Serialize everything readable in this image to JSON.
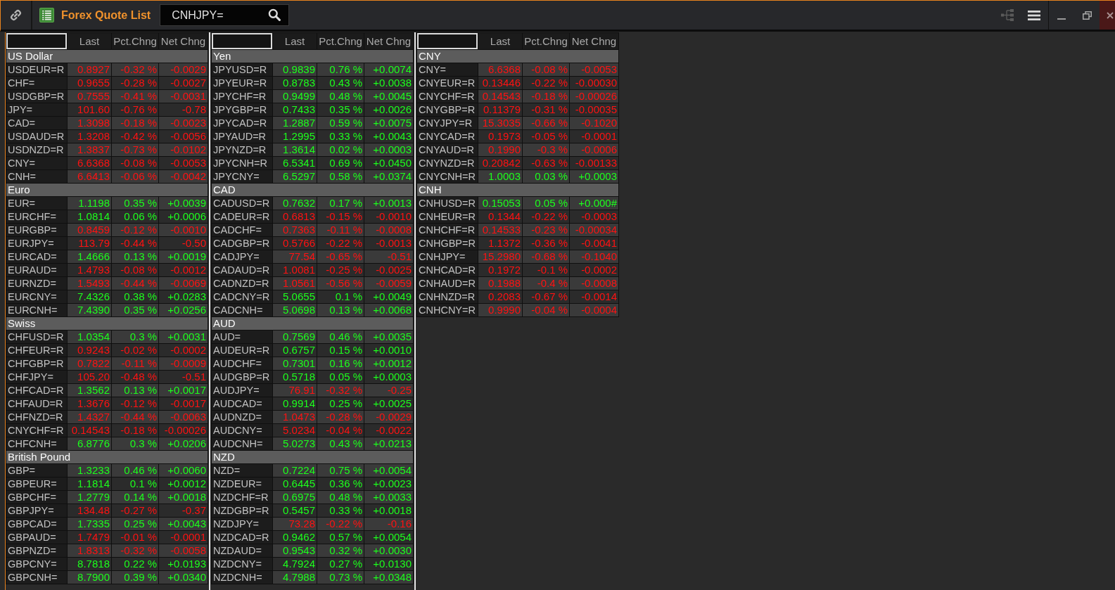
{
  "window": {
    "title": "Forex Quote List",
    "search": {
      "value": "CNHJPY="
    }
  },
  "quote_lists": [
    {
      "columns": [
        "Last",
        "Pct.Chng",
        "Net Chng"
      ],
      "groups": [
        {
          "heading": "US Dollar",
          "rows": [
            {
              "symbol": "USDEUR=R",
              "last": "0.8927",
              "pct_change": "-0.32 %",
              "net_change": "-0.0029",
              "rising": false
            },
            {
              "symbol": "CHF=",
              "last": "0.9655",
              "pct_change": "-0.28 %",
              "net_change": "-0.0027",
              "rising": false
            },
            {
              "symbol": "USDGBP=R",
              "last": "0.7555",
              "pct_change": "-0.41 %",
              "net_change": "-0.0031",
              "rising": false
            },
            {
              "symbol": "JPY=",
              "last": "101.60",
              "pct_change": "-0.76 %",
              "net_change": "-0.78",
              "rising": false
            },
            {
              "symbol": "CAD=",
              "last": "1.3098",
              "pct_change": "-0.18 %",
              "net_change": "-0.0023",
              "rising": false
            },
            {
              "symbol": "USDAUD=R",
              "last": "1.3208",
              "pct_change": "-0.42 %",
              "net_change": "-0.0056",
              "rising": false
            },
            {
              "symbol": "USDNZD=R",
              "last": "1.3837",
              "pct_change": "-0.73 %",
              "net_change": "-0.0102",
              "rising": false
            },
            {
              "symbol": "CNY=",
              "last": "6.6368",
              "pct_change": "-0.08 %",
              "net_change": "-0.0053",
              "rising": false
            },
            {
              "symbol": "CNH=",
              "last": "6.6413",
              "pct_change": "-0.06 %",
              "net_change": "-0.0042",
              "rising": false
            }
          ]
        },
        {
          "heading": "Euro",
          "rows": [
            {
              "symbol": "EUR=",
              "last": "1.1198",
              "pct_change": "0.35 %",
              "net_change": "+0.0039",
              "rising": true
            },
            {
              "symbol": "EURCHF=",
              "last": "1.0814",
              "pct_change": "0.06 %",
              "net_change": "+0.0006",
              "rising": true
            },
            {
              "symbol": "EURGBP=",
              "last": "0.8459",
              "pct_change": "-0.12 %",
              "net_change": "-0.0010",
              "rising": false
            },
            {
              "symbol": "EURJPY=",
              "last": "113.79",
              "pct_change": "-0.44 %",
              "net_change": "-0.50",
              "rising": false
            },
            {
              "symbol": "EURCAD=",
              "last": "1.4666",
              "pct_change": "0.13 %",
              "net_change": "+0.0019",
              "rising": true
            },
            {
              "symbol": "EURAUD=",
              "last": "1.4793",
              "pct_change": "-0.08 %",
              "net_change": "-0.0012",
              "rising": false
            },
            {
              "symbol": "EURNZD=",
              "last": "1.5493",
              "pct_change": "-0.44 %",
              "net_change": "-0.0069",
              "rising": false
            },
            {
              "symbol": "EURCNY=",
              "last": "7.4326",
              "pct_change": "0.38 %",
              "net_change": "+0.0283",
              "rising": true
            },
            {
              "symbol": "EURCNH=",
              "last": "7.4390",
              "pct_change": "0.35 %",
              "net_change": "+0.0256",
              "rising": true
            }
          ]
        },
        {
          "heading": "Swiss",
          "rows": [
            {
              "symbol": "CHFUSD=R",
              "last": "1.0354",
              "pct_change": "0.3 %",
              "net_change": "+0.0031",
              "rising": true
            },
            {
              "symbol": "CHFEUR=R",
              "last": "0.9243",
              "pct_change": "-0.02 %",
              "net_change": "-0.0002",
              "rising": false
            },
            {
              "symbol": "CHFGBP=R",
              "last": "0.7822",
              "pct_change": "-0.11 %",
              "net_change": "-0.0009",
              "rising": false
            },
            {
              "symbol": "CHFJPY=",
              "last": "105.20",
              "pct_change": "-0.48 %",
              "net_change": "-0.51",
              "rising": false
            },
            {
              "symbol": "CHFCAD=R",
              "last": "1.3562",
              "pct_change": "0.13 %",
              "net_change": "+0.0017",
              "rising": true
            },
            {
              "symbol": "CHFAUD=R",
              "last": "1.3676",
              "pct_change": "-0.12 %",
              "net_change": "-0.0017",
              "rising": false
            },
            {
              "symbol": "CHFNZD=R",
              "last": "1.4327",
              "pct_change": "-0.44 %",
              "net_change": "-0.0063",
              "rising": false
            },
            {
              "symbol": "CNYCHF=R",
              "last": "0.14543",
              "pct_change": "-0.18 %",
              "net_change": "-0.00026",
              "rising": false
            },
            {
              "symbol": "CHFCNH=",
              "last": "6.8776",
              "pct_change": "0.3 %",
              "net_change": "+0.0206",
              "rising": true
            }
          ]
        },
        {
          "heading": "British Pound",
          "rows": [
            {
              "symbol": "GBP=",
              "last": "1.3233",
              "pct_change": "0.46 %",
              "net_change": "+0.0060",
              "rising": true
            },
            {
              "symbol": "GBPEUR=",
              "last": "1.1814",
              "pct_change": "0.1 %",
              "net_change": "+0.0012",
              "rising": true
            },
            {
              "symbol": "GBPCHF=",
              "last": "1.2779",
              "pct_change": "0.14 %",
              "net_change": "+0.0018",
              "rising": true
            },
            {
              "symbol": "GBPJPY=",
              "last": "134.48",
              "pct_change": "-0.27 %",
              "net_change": "-0.37",
              "rising": false
            },
            {
              "symbol": "GBPCAD=",
              "last": "1.7335",
              "pct_change": "0.25 %",
              "net_change": "+0.0043",
              "rising": true
            },
            {
              "symbol": "GBPAUD=",
              "last": "1.7479",
              "pct_change": "-0.01 %",
              "net_change": "-0.0001",
              "rising": false
            },
            {
              "symbol": "GBPNZD=",
              "last": "1.8313",
              "pct_change": "-0.32 %",
              "net_change": "-0.0058",
              "rising": false
            },
            {
              "symbol": "GBPCNY=",
              "last": "8.7818",
              "pct_change": "0.22 %",
              "net_change": "+0.0193",
              "rising": true
            },
            {
              "symbol": "GBPCNH=",
              "last": "8.7900",
              "pct_change": "0.39 %",
              "net_change": "+0.0340",
              "rising": true
            }
          ]
        }
      ]
    },
    {
      "columns": [
        "Last",
        "Pct.Chng",
        "Net Chng"
      ],
      "groups": [
        {
          "heading": "Yen",
          "rows": [
            {
              "symbol": "JPYUSD=R",
              "last": "0.9839",
              "pct_change": "0.76 %",
              "net_change": "+0.0074",
              "rising": true
            },
            {
              "symbol": "JPYEUR=R",
              "last": "0.8783",
              "pct_change": "0.43 %",
              "net_change": "+0.0038",
              "rising": true
            },
            {
              "symbol": "JPYCHF=R",
              "last": "0.9499",
              "pct_change": "0.48 %",
              "net_change": "+0.0045",
              "rising": true
            },
            {
              "symbol": "JPYGBP=R",
              "last": "0.7433",
              "pct_change": "0.35 %",
              "net_change": "+0.0026",
              "rising": true
            },
            {
              "symbol": "JPYCAD=R",
              "last": "1.2887",
              "pct_change": "0.59 %",
              "net_change": "+0.0075",
              "rising": true
            },
            {
              "symbol": "JPYAUD=R",
              "last": "1.2995",
              "pct_change": "0.33 %",
              "net_change": "+0.0043",
              "rising": true
            },
            {
              "symbol": "JPYNZD=R",
              "last": "1.3614",
              "pct_change": "0.02 %",
              "net_change": "+0.0003",
              "rising": true
            },
            {
              "symbol": "JPYCNH=R",
              "last": "6.5341",
              "pct_change": "0.69 %",
              "net_change": "+0.0450",
              "rising": true
            },
            {
              "symbol": "JPYCNY=",
              "last": "6.5297",
              "pct_change": "0.58 %",
              "net_change": "+0.0374",
              "rising": true
            }
          ]
        },
        {
          "heading": "CAD",
          "rows": [
            {
              "symbol": "CADUSD=R",
              "last": "0.7632",
              "pct_change": "0.17 %",
              "net_change": "+0.0013",
              "rising": true
            },
            {
              "symbol": "CADEUR=R",
              "last": "0.6813",
              "pct_change": "-0.15 %",
              "net_change": "-0.0010",
              "rising": false
            },
            {
              "symbol": "CADCHF=",
              "last": "0.7363",
              "pct_change": "-0.11 %",
              "net_change": "-0.0008",
              "rising": false
            },
            {
              "symbol": "CADGBP=R",
              "last": "0.5766",
              "pct_change": "-0.22 %",
              "net_change": "-0.0013",
              "rising": false
            },
            {
              "symbol": "CADJPY=",
              "last": "77.54",
              "pct_change": "-0.65 %",
              "net_change": "-0.51",
              "rising": false
            },
            {
              "symbol": "CADAUD=R",
              "last": "1.0081",
              "pct_change": "-0.25 %",
              "net_change": "-0.0025",
              "rising": false
            },
            {
              "symbol": "CADNZD=R",
              "last": "1.0561",
              "pct_change": "-0.56 %",
              "net_change": "-0.0059",
              "rising": false
            },
            {
              "symbol": "CADCNY=R",
              "last": "5.0655",
              "pct_change": "0.1 %",
              "net_change": "+0.0049",
              "rising": true
            },
            {
              "symbol": "CADCNH=",
              "last": "5.0698",
              "pct_change": "0.13 %",
              "net_change": "+0.0068",
              "rising": true
            }
          ]
        },
        {
          "heading": "AUD",
          "rows": [
            {
              "symbol": "AUD=",
              "last": "0.7569",
              "pct_change": "0.46 %",
              "net_change": "+0.0035",
              "rising": true
            },
            {
              "symbol": "AUDEUR=R",
              "last": "0.6757",
              "pct_change": "0.15 %",
              "net_change": "+0.0010",
              "rising": true
            },
            {
              "symbol": "AUDCHF=",
              "last": "0.7301",
              "pct_change": "0.16 %",
              "net_change": "+0.0012",
              "rising": true
            },
            {
              "symbol": "AUDGBP=R",
              "last": "0.5718",
              "pct_change": "0.05 %",
              "net_change": "+0.0003",
              "rising": true
            },
            {
              "symbol": "AUDJPY=",
              "last": "76.91",
              "pct_change": "-0.32 %",
              "net_change": "-0.25",
              "rising": false
            },
            {
              "symbol": "AUDCAD=",
              "last": "0.9914",
              "pct_change": "0.25 %",
              "net_change": "+0.0025",
              "rising": true
            },
            {
              "symbol": "AUDNZD=",
              "last": "1.0473",
              "pct_change": "-0.28 %",
              "net_change": "-0.0029",
              "rising": false
            },
            {
              "symbol": "AUDCNY=",
              "last": "5.0234",
              "pct_change": "-0.04 %",
              "net_change": "-0.0022",
              "rising": false
            },
            {
              "symbol": "AUDCNH=",
              "last": "5.0273",
              "pct_change": "0.43 %",
              "net_change": "+0.0213",
              "rising": true
            }
          ]
        },
        {
          "heading": "NZD",
          "rows": [
            {
              "symbol": "NZD=",
              "last": "0.7224",
              "pct_change": "0.75 %",
              "net_change": "+0.0054",
              "rising": true
            },
            {
              "symbol": "NZDEUR=",
              "last": "0.6445",
              "pct_change": "0.36 %",
              "net_change": "+0.0023",
              "rising": true
            },
            {
              "symbol": "NZDCHF=R",
              "last": "0.6975",
              "pct_change": "0.48 %",
              "net_change": "+0.0033",
              "rising": true
            },
            {
              "symbol": "NZDGBP=R",
              "last": "0.5457",
              "pct_change": "0.33 %",
              "net_change": "+0.0018",
              "rising": true
            },
            {
              "symbol": "NZDJPY=",
              "last": "73.28",
              "pct_change": "-0.22 %",
              "net_change": "-0.16",
              "rising": false
            },
            {
              "symbol": "NZDCAD=R",
              "last": "0.9462",
              "pct_change": "0.57 %",
              "net_change": "+0.0054",
              "rising": true
            },
            {
              "symbol": "NZDAUD=",
              "last": "0.9543",
              "pct_change": "0.32 %",
              "net_change": "+0.0030",
              "rising": true
            },
            {
              "symbol": "NZDCNY=",
              "last": "4.7924",
              "pct_change": "0.27 %",
              "net_change": "+0.0130",
              "rising": true
            },
            {
              "symbol": "NZDCNH=",
              "last": "4.7988",
              "pct_change": "0.73 %",
              "net_change": "+0.0348",
              "rising": true
            }
          ]
        }
      ]
    },
    {
      "columns": [
        "Last",
        "Pct.Chng",
        "Net Chng"
      ],
      "groups": [
        {
          "heading": "CNY",
          "rows": [
            {
              "symbol": "CNY=",
              "last": "6.6368",
              "pct_change": "-0.08 %",
              "net_change": "-0.0053",
              "rising": false
            },
            {
              "symbol": "CNYEUR=R",
              "last": "0.13446",
              "pct_change": "-0.22 %",
              "net_change": "-0.00030",
              "rising": false
            },
            {
              "symbol": "CNYCHF=R",
              "last": "0.14543",
              "pct_change": "-0.18 %",
              "net_change": "-0.00026",
              "rising": false
            },
            {
              "symbol": "CNYGBP=R",
              "last": "0.11379",
              "pct_change": "-0.31 %",
              "net_change": "-0.00035",
              "rising": false
            },
            {
              "symbol": "CNYJPY=R",
              "last": "15.3035",
              "pct_change": "-0.66 %",
              "net_change": "-0.1020",
              "rising": false
            },
            {
              "symbol": "CNYCAD=R",
              "last": "0.1973",
              "pct_change": "-0.05 %",
              "net_change": "-0.0001",
              "rising": false
            },
            {
              "symbol": "CNYAUD=R",
              "last": "0.1990",
              "pct_change": "-0.3 %",
              "net_change": "-0.0006",
              "rising": false
            },
            {
              "symbol": "CNYNZD=R",
              "last": "0.20842",
              "pct_change": "-0.63 %",
              "net_change": "-0.00133",
              "rising": false
            },
            {
              "symbol": "CNYCNH=R",
              "last": "1.0003",
              "pct_change": "0.03 %",
              "net_change": "+0.0003",
              "rising": true
            }
          ]
        },
        {
          "heading": "CNH",
          "rows": [
            {
              "symbol": "CNHUSD=R",
              "last": "0.15053",
              "pct_change": "0.05 %",
              "net_change": "+0.000#",
              "rising": true
            },
            {
              "symbol": "CNHEUR=R",
              "last": "0.1344",
              "pct_change": "-0.22 %",
              "net_change": "-0.0003",
              "rising": false
            },
            {
              "symbol": "CNHCHF=R",
              "last": "0.14533",
              "pct_change": "-0.23 %",
              "net_change": "-0.00034",
              "rising": false
            },
            {
              "symbol": "CNHGBP=R",
              "last": "1.1372",
              "pct_change": "-0.36 %",
              "net_change": "-0.0041",
              "rising": false
            },
            {
              "symbol": "CNHJPY=",
              "last": "15.2980",
              "pct_change": "-0.68 %",
              "net_change": "-0.1040",
              "rising": false
            },
            {
              "symbol": "CNHCAD=R",
              "last": "0.1972",
              "pct_change": "-0.1 %",
              "net_change": "-0.0002",
              "rising": false
            },
            {
              "symbol": "CNHAUD=R",
              "last": "0.1988",
              "pct_change": "-0.4 %",
              "net_change": "-0.0008",
              "rising": false
            },
            {
              "symbol": "CNHNZD=R",
              "last": "0.2083",
              "pct_change": "-0.67 %",
              "net_change": "-0.0014",
              "rising": false
            },
            {
              "symbol": "CNHCNY=R",
              "last": "0.9990",
              "pct_change": "-0.04 %",
              "net_change": "-0.0004",
              "rising": false
            }
          ]
        }
      ]
    }
  ]
}
